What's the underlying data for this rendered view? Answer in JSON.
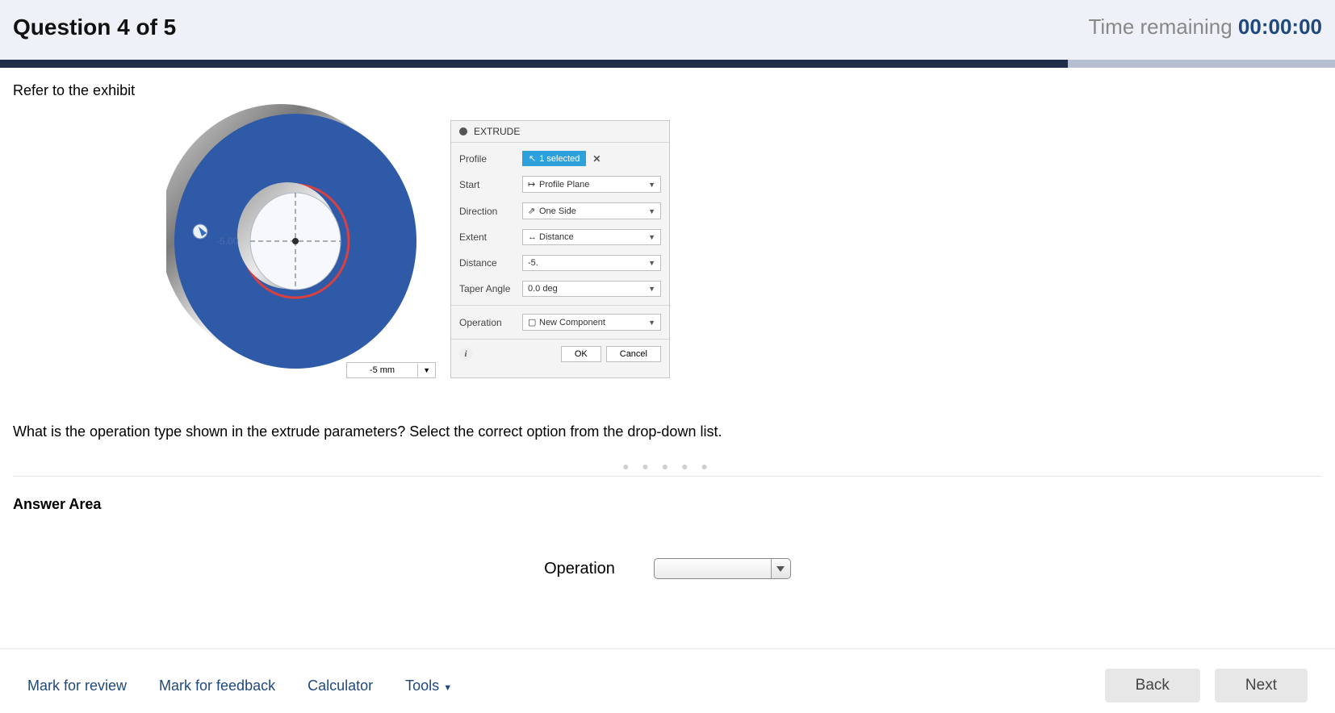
{
  "header": {
    "title": "Question 4 of 5",
    "timeLabel": "Time remaining ",
    "timeValue": "00:00:00"
  },
  "progressPercent": 80,
  "instruction": "Refer to the exhibit",
  "pill": "-5 mm",
  "panel": {
    "title": "EXTRUDE",
    "rows": {
      "profileLbl": "Profile",
      "profileVal": "1 selected",
      "startLbl": "Start",
      "startVal": "Profile Plane",
      "directionLbl": "Direction",
      "directionVal": "One Side",
      "extentLbl": "Extent",
      "extentVal": "Distance",
      "distanceLbl": "Distance",
      "distanceVal": "-5.",
      "taperLbl": "Taper Angle",
      "taperVal": "0.0 deg",
      "operationLbl": "Operation",
      "operationVal": "New Component"
    },
    "ok": "OK",
    "cancel": "Cancel"
  },
  "question": "What is the operation type shown in the extrude parameters? Select the correct option from the drop-down list.",
  "answerAreaLabel": "Answer Area",
  "answerFieldLabel": "Operation",
  "footer": {
    "mark": "Mark for review",
    "feedback": "Mark for feedback",
    "calc": "Calculator",
    "tools": "Tools",
    "back": "Back",
    "next": "Next"
  }
}
